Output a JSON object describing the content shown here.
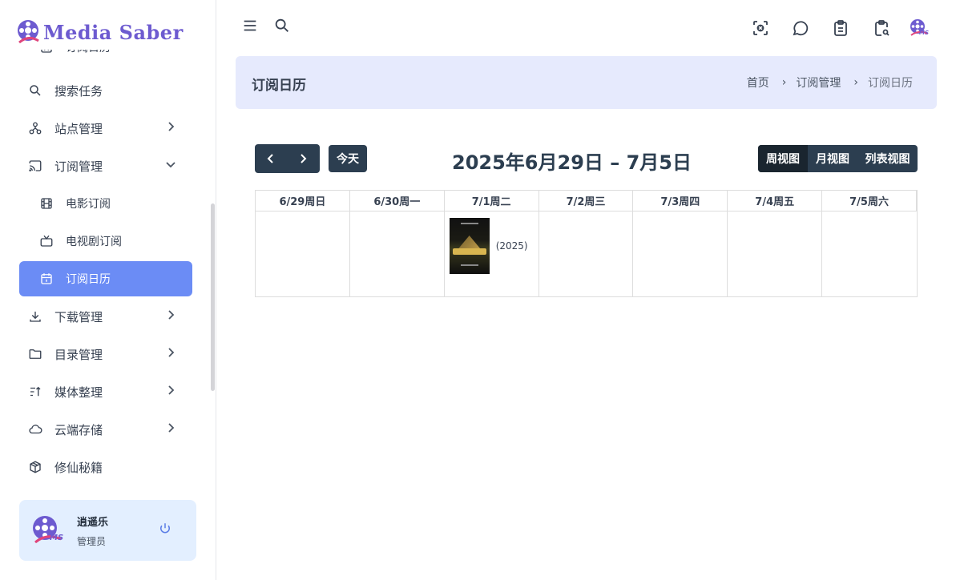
{
  "app": {
    "brand": "Media Saber"
  },
  "sidebar": {
    "items": [
      {
        "label": "订阅日历",
        "icon": "calendar-icon",
        "cut": true
      },
      {
        "label": "搜索任务",
        "icon": "search-icon"
      },
      {
        "label": "站点管理",
        "icon": "sitemap-icon",
        "chevron": "right"
      },
      {
        "label": "订阅管理",
        "icon": "cast-icon",
        "chevron": "down"
      },
      {
        "label": "电影订阅",
        "icon": "movie-icon",
        "sub": true
      },
      {
        "label": "电视剧订阅",
        "icon": "tv-icon",
        "sub": true
      },
      {
        "label": "订阅日历",
        "icon": "calendar-icon",
        "sub": true,
        "active": true
      },
      {
        "label": "下载管理",
        "icon": "download-icon",
        "chevron": "right"
      },
      {
        "label": "目录管理",
        "icon": "folder-icon",
        "chevron": "right"
      },
      {
        "label": "媒体整理",
        "icon": "sort-icon",
        "chevron": "right"
      },
      {
        "label": "云端存储",
        "icon": "cloud-icon",
        "chevron": "right"
      },
      {
        "label": "修仙秘籍",
        "icon": "package-icon"
      }
    ],
    "user": {
      "name": "逍遥乐",
      "role": "管理员"
    }
  },
  "header": {
    "page_title": "订阅日历",
    "breadcrumbs": [
      "首页",
      "订阅管理",
      "订阅日历"
    ]
  },
  "calendar": {
    "today_label": "今天",
    "title": "2025年6月29日 – 7月5日",
    "views": [
      {
        "label": "周视图",
        "active": true
      },
      {
        "label": "月视图",
        "active": false
      },
      {
        "label": "列表视图",
        "active": false
      }
    ],
    "days": [
      "6/29周日",
      "6/30周一",
      "7/1周二",
      "7/2周三",
      "7/3周四",
      "7/4周五",
      "7/5周六"
    ],
    "events": [
      {
        "day_index": 2,
        "year_label": "(2025)"
      }
    ]
  },
  "colors": {
    "brand": "#6d5bd0",
    "active_nav": "#6b8cf5",
    "crumb_bg": "#e6eafd",
    "calendar_button": "#2c3e50",
    "user_card": "#e3efff"
  }
}
